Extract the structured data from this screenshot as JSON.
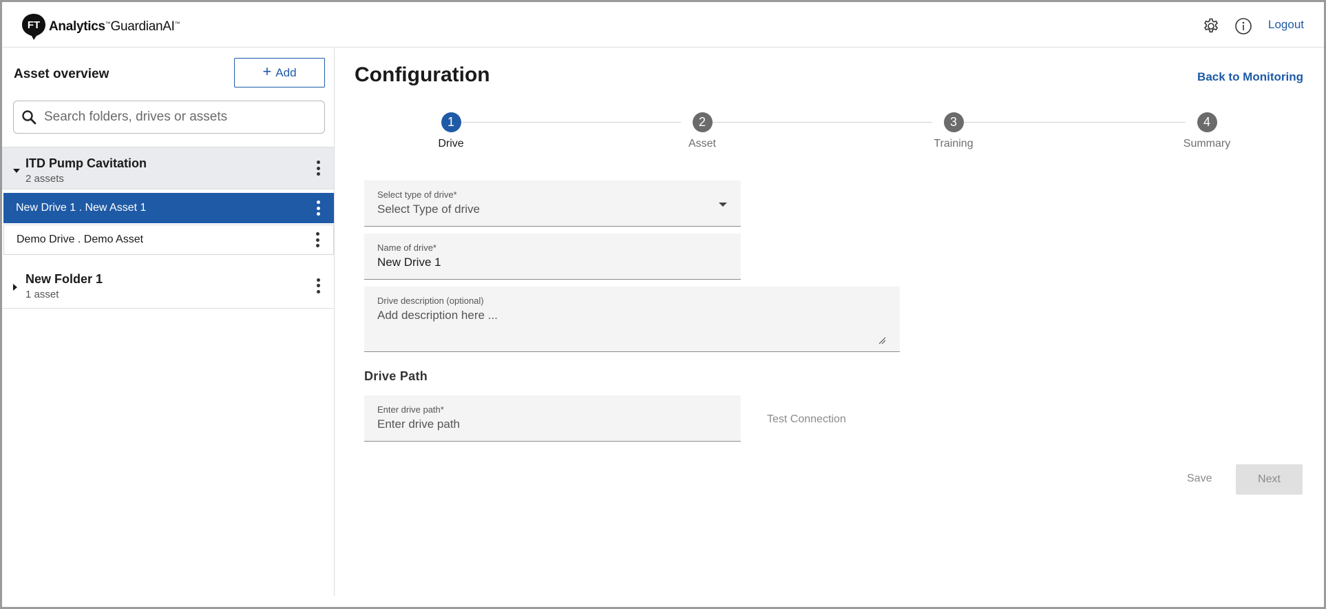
{
  "header": {
    "brand_bold": "Analytics",
    "brand_tm1": "™",
    "brand_product": "GuardianAI",
    "brand_tm2": "™",
    "logo_mark": "FT",
    "settings_icon": "gear-icon",
    "info_icon": "info-icon",
    "logout_label": "Logout"
  },
  "sidebar": {
    "title": "Asset overview",
    "add_label": "Add",
    "search_placeholder": "Search folders, drives or assets",
    "folders": [
      {
        "name": "ITD Pump Cavitation",
        "count": "2 assets",
        "expanded": true,
        "assets": [
          {
            "label": "New Drive 1 . New Asset 1",
            "selected": true
          },
          {
            "label": "Demo Drive . Demo Asset",
            "selected": false
          }
        ]
      },
      {
        "name": "New Folder 1",
        "count": "1 asset",
        "expanded": false
      }
    ]
  },
  "main": {
    "title": "Configuration",
    "back_link": "Back to Monitoring",
    "steps": [
      {
        "number": "1",
        "label": "Drive",
        "active": true
      },
      {
        "number": "2",
        "label": "Asset",
        "active": false
      },
      {
        "number": "3",
        "label": "Training",
        "active": false
      },
      {
        "number": "4",
        "label": "Summary",
        "active": false
      }
    ],
    "form": {
      "drive_type": {
        "label": "Select type of drive*",
        "value": "Select Type of drive"
      },
      "drive_name": {
        "label": "Name of drive*",
        "value": "New Drive 1"
      },
      "drive_description": {
        "label": "Drive description (optional)",
        "placeholder": "Add description here ..."
      },
      "section_drive_path": "Drive Path",
      "drive_path": {
        "label": "Enter drive path*",
        "placeholder": "Enter drive path"
      },
      "test_connection": "Test Connection"
    },
    "actions": {
      "save": "Save",
      "next": "Next"
    }
  },
  "colors": {
    "primary": "#1f5aa6",
    "selected_row_bg": "#1f5aa6",
    "folder_bg": "#e9ebee",
    "field_bg": "#f4f4f4",
    "disabled_bg": "#e0e0e0",
    "disabled_text": "#8a8a8a",
    "step_inactive": "#6b6b6b"
  }
}
